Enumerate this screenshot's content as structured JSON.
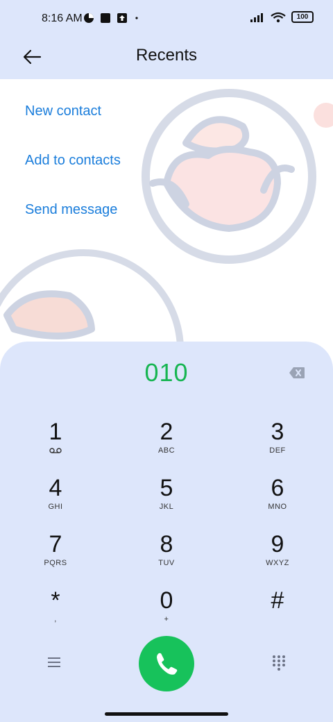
{
  "status_bar": {
    "time": "8:16 AM",
    "battery": "100",
    "icons_left": [
      "game-icon",
      "square-notification-icon",
      "upload-icon",
      "dot-icon"
    ],
    "icons_right": [
      "signal-icon",
      "wifi-icon",
      "battery-icon"
    ]
  },
  "header": {
    "title": "Recents",
    "back_icon": "arrow-left-icon"
  },
  "actions": {
    "new_contact": "New contact",
    "add_to_contacts": "Add to contacts",
    "send_message": "Send message"
  },
  "dialer": {
    "number": "010",
    "backspace_icon": "backspace-icon",
    "keys": [
      {
        "digit": "1",
        "letters": ""
      },
      {
        "digit": "2",
        "letters": "ABC"
      },
      {
        "digit": "3",
        "letters": "DEF"
      },
      {
        "digit": "4",
        "letters": "GHI"
      },
      {
        "digit": "5",
        "letters": "JKL"
      },
      {
        "digit": "6",
        "letters": "MNO"
      },
      {
        "digit": "7",
        "letters": "PQRS"
      },
      {
        "digit": "8",
        "letters": "TUV"
      },
      {
        "digit": "9",
        "letters": "WXYZ"
      },
      {
        "digit": "*",
        "letters": ","
      },
      {
        "digit": "0",
        "letters": "+"
      },
      {
        "digit": "#",
        "letters": ""
      }
    ],
    "menu_icon": "hamburger-menu-icon",
    "call_icon": "phone-icon",
    "keypad_icon": "keypad-grid-icon"
  },
  "colors": {
    "accent_blue": "#1a7ddb",
    "dialed_green": "#17b552",
    "call_green": "#17c25b",
    "panel_bg": "#dde6fb"
  }
}
